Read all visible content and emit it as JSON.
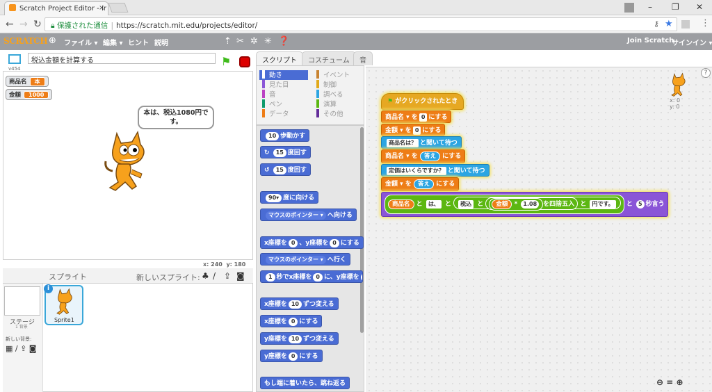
{
  "browser": {
    "tab_title": "Scratch Project Editor - Ir",
    "close": "×",
    "secure_label": "保護された通信",
    "url": "https://scratch.mit.edu/projects/editor/",
    "minimize": "–",
    "maximize": "❐",
    "close_window": "✕"
  },
  "menubar": {
    "logo": "SCRATCH",
    "file": "ファイル ▾",
    "edit": "編集 ▾",
    "hint": "ヒント",
    "about": "説明",
    "join": "Join Scratch",
    "signin": "サインイン ▾"
  },
  "stage": {
    "project_name": "税込金額を計算する",
    "version": "v454",
    "monitors": [
      {
        "label": "商品名",
        "value": "本"
      },
      {
        "label": "金額",
        "value": "1000"
      }
    ],
    "speech": "本は、税込1080円です。",
    "coords_x_label": "x:",
    "coords_x": "240",
    "coords_y_label": "y:",
    "coords_y": "180"
  },
  "sprites": {
    "title": "スプライト",
    "new_sprite": "新しいスプライト:",
    "stage_label": "ステージ",
    "stage_sub": "1 背景",
    "new_backdrop": "新しい背景:",
    "sprite1": "Sprite1",
    "info": "i"
  },
  "tabs": {
    "scripts": "スクリプト",
    "costumes": "コスチューム",
    "sounds": "音"
  },
  "categories": [
    {
      "label": "動き",
      "color": "#4a6cd4"
    },
    {
      "label": "イベント",
      "color": "#c88330"
    },
    {
      "label": "見た目",
      "color": "#8a55d7"
    },
    {
      "label": "制御",
      "color": "#e1a91a"
    },
    {
      "label": "音",
      "color": "#bb42c3"
    },
    {
      "label": "調べる",
      "color": "#2ca5e2"
    },
    {
      "label": "ペン",
      "color": "#0e9a6c"
    },
    {
      "label": "演算",
      "color": "#5cb712"
    },
    {
      "label": "データ",
      "color": "#ee7d16"
    },
    {
      "label": "その他",
      "color": "#632d99"
    }
  ],
  "palette": {
    "move": {
      "n": "10",
      "t": "歩動かす"
    },
    "turn_r": {
      "icon": "↻",
      "n": "15",
      "t": "度回す"
    },
    "turn_l": {
      "icon": "↺",
      "n": "15",
      "t": "度回す"
    },
    "point_dir": {
      "n": "90▾",
      "t": "度に向ける"
    },
    "point_to": {
      "a": "マウスのポインター ▾",
      "t": "へ向ける"
    },
    "goto_xy": {
      "a": "x座標を",
      "x": "0",
      "b": "、y座標を",
      "y": "0",
      "c": "にする"
    },
    "goto": {
      "a": "マウスのポインター ▾",
      "t": "へ行く"
    },
    "glide": {
      "n": "1",
      "a": "秒でx座標を",
      "x": "0",
      "b": "に、y座標を",
      "y": "0"
    },
    "change_x": {
      "a": "x座標を",
      "n": "10",
      "b": "ずつ変える"
    },
    "set_x": {
      "a": "x座標を",
      "n": "0",
      "b": "にする"
    },
    "change_y": {
      "a": "y座標を",
      "n": "10",
      "b": "ずつ変える"
    },
    "set_y": {
      "a": "y座標を",
      "n": "0",
      "b": "にする"
    },
    "bounce": "もし端に着いたら、跳ね返る"
  },
  "script": {
    "hat": "がクリックされたとき",
    "set_name": {
      "var": "商品名 ▾",
      "a": "を",
      "v": "0",
      "b": "にする"
    },
    "set_amount": {
      "var": "金額 ▾",
      "a": "を",
      "v": "0",
      "b": "にする"
    },
    "ask1": {
      "q": "商品名は？",
      "t": "と聞いて待つ"
    },
    "set_name2": {
      "var": "商品名 ▾",
      "a": "を",
      "ans": "答え",
      "b": "にする"
    },
    "ask2": {
      "q": "定価はいくらですか？",
      "t": "と聞いて待つ"
    },
    "set_amount2": {
      "var": "金額 ▾",
      "a": "を",
      "ans": "答え",
      "b": "にする"
    },
    "say": {
      "v1": "商品名",
      "to1": "と",
      "s1": "は、",
      "to2": "と",
      "s2": "税込",
      "to3": "と",
      "v2": "金額",
      "mul": "*",
      "n": "1.08",
      "round": "を四捨五入",
      "to4": "と",
      "s3": "円です。",
      "to5": "と",
      "secs": "5",
      "t": "秒言う"
    }
  },
  "sprite_info": {
    "x_label": "x:",
    "x": "0",
    "y_label": "y:",
    "y": "0"
  },
  "zoom": {
    "out": "🔍",
    "reset": "=",
    "in": "🔍"
  }
}
